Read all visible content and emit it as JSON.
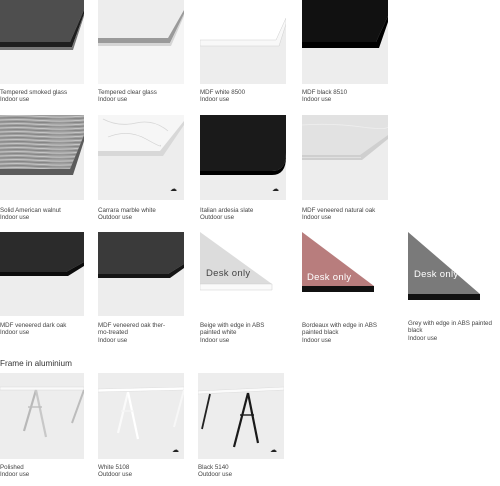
{
  "swatches": [
    {
      "name": "Tempered smoked glass",
      "use": "Indoor use"
    },
    {
      "name": "Tempered clear glass",
      "use": "Indoor use"
    },
    {
      "name": "MDF white 8500",
      "use": "Indoor use"
    },
    {
      "name": "MDF black 8510",
      "use": "Indoor use"
    },
    {
      "name": "Solid American walnut",
      "use": "Indoor use"
    },
    {
      "name": "Carrara marble white",
      "use": "Outdoor use"
    },
    {
      "name": "Italian ardesia slate",
      "use": "Outdoor use"
    },
    {
      "name": "MDF veneered natural oak",
      "use": "Indoor use"
    },
    {
      "name": "MDF veneered dark oak",
      "use": "Indoor use"
    },
    {
      "name": "MDF veneered oak ther-",
      "name2": "mo-treated",
      "use": "Indoor use"
    },
    {
      "name": "Beige with edge in ABS",
      "name2": "painted white",
      "use": "Indoor use",
      "tag": "Desk only"
    },
    {
      "name": "Bordeaux with edge in ABS",
      "name2": "painted black",
      "use": "Indoor use",
      "tag": "Desk only"
    },
    {
      "name": "Grey with edge in ABS painted",
      "name2": "black",
      "use": "Indoor use",
      "tag": "Desk only"
    }
  ],
  "section": {
    "title": "Frame in aluminium"
  },
  "frames": [
    {
      "name": "Polished",
      "use": "Indoor use"
    },
    {
      "name": "White 5108",
      "use": "Outdoor use"
    },
    {
      "name": "Black 5140",
      "use": "Outdoor use"
    }
  ],
  "icons": {
    "outdoor": "outdoor-use-icon"
  },
  "colors": {
    "smoked_glass": "#5f5f5f",
    "clear_glass": "#ececec",
    "mdf_white": "#ffffff",
    "mdf_black": "#121212",
    "walnut": "#a8a8a8",
    "marble": "#f2f2f2",
    "slate": "#1c1c1c",
    "natural_oak": "#e6e6e6",
    "dark_oak": "#2a2a2a",
    "thermo_oak": "#3b3b3b",
    "beige": "#dcdcdc",
    "bordeaux": "#b77c7c",
    "grey": "#7a7a7a"
  }
}
